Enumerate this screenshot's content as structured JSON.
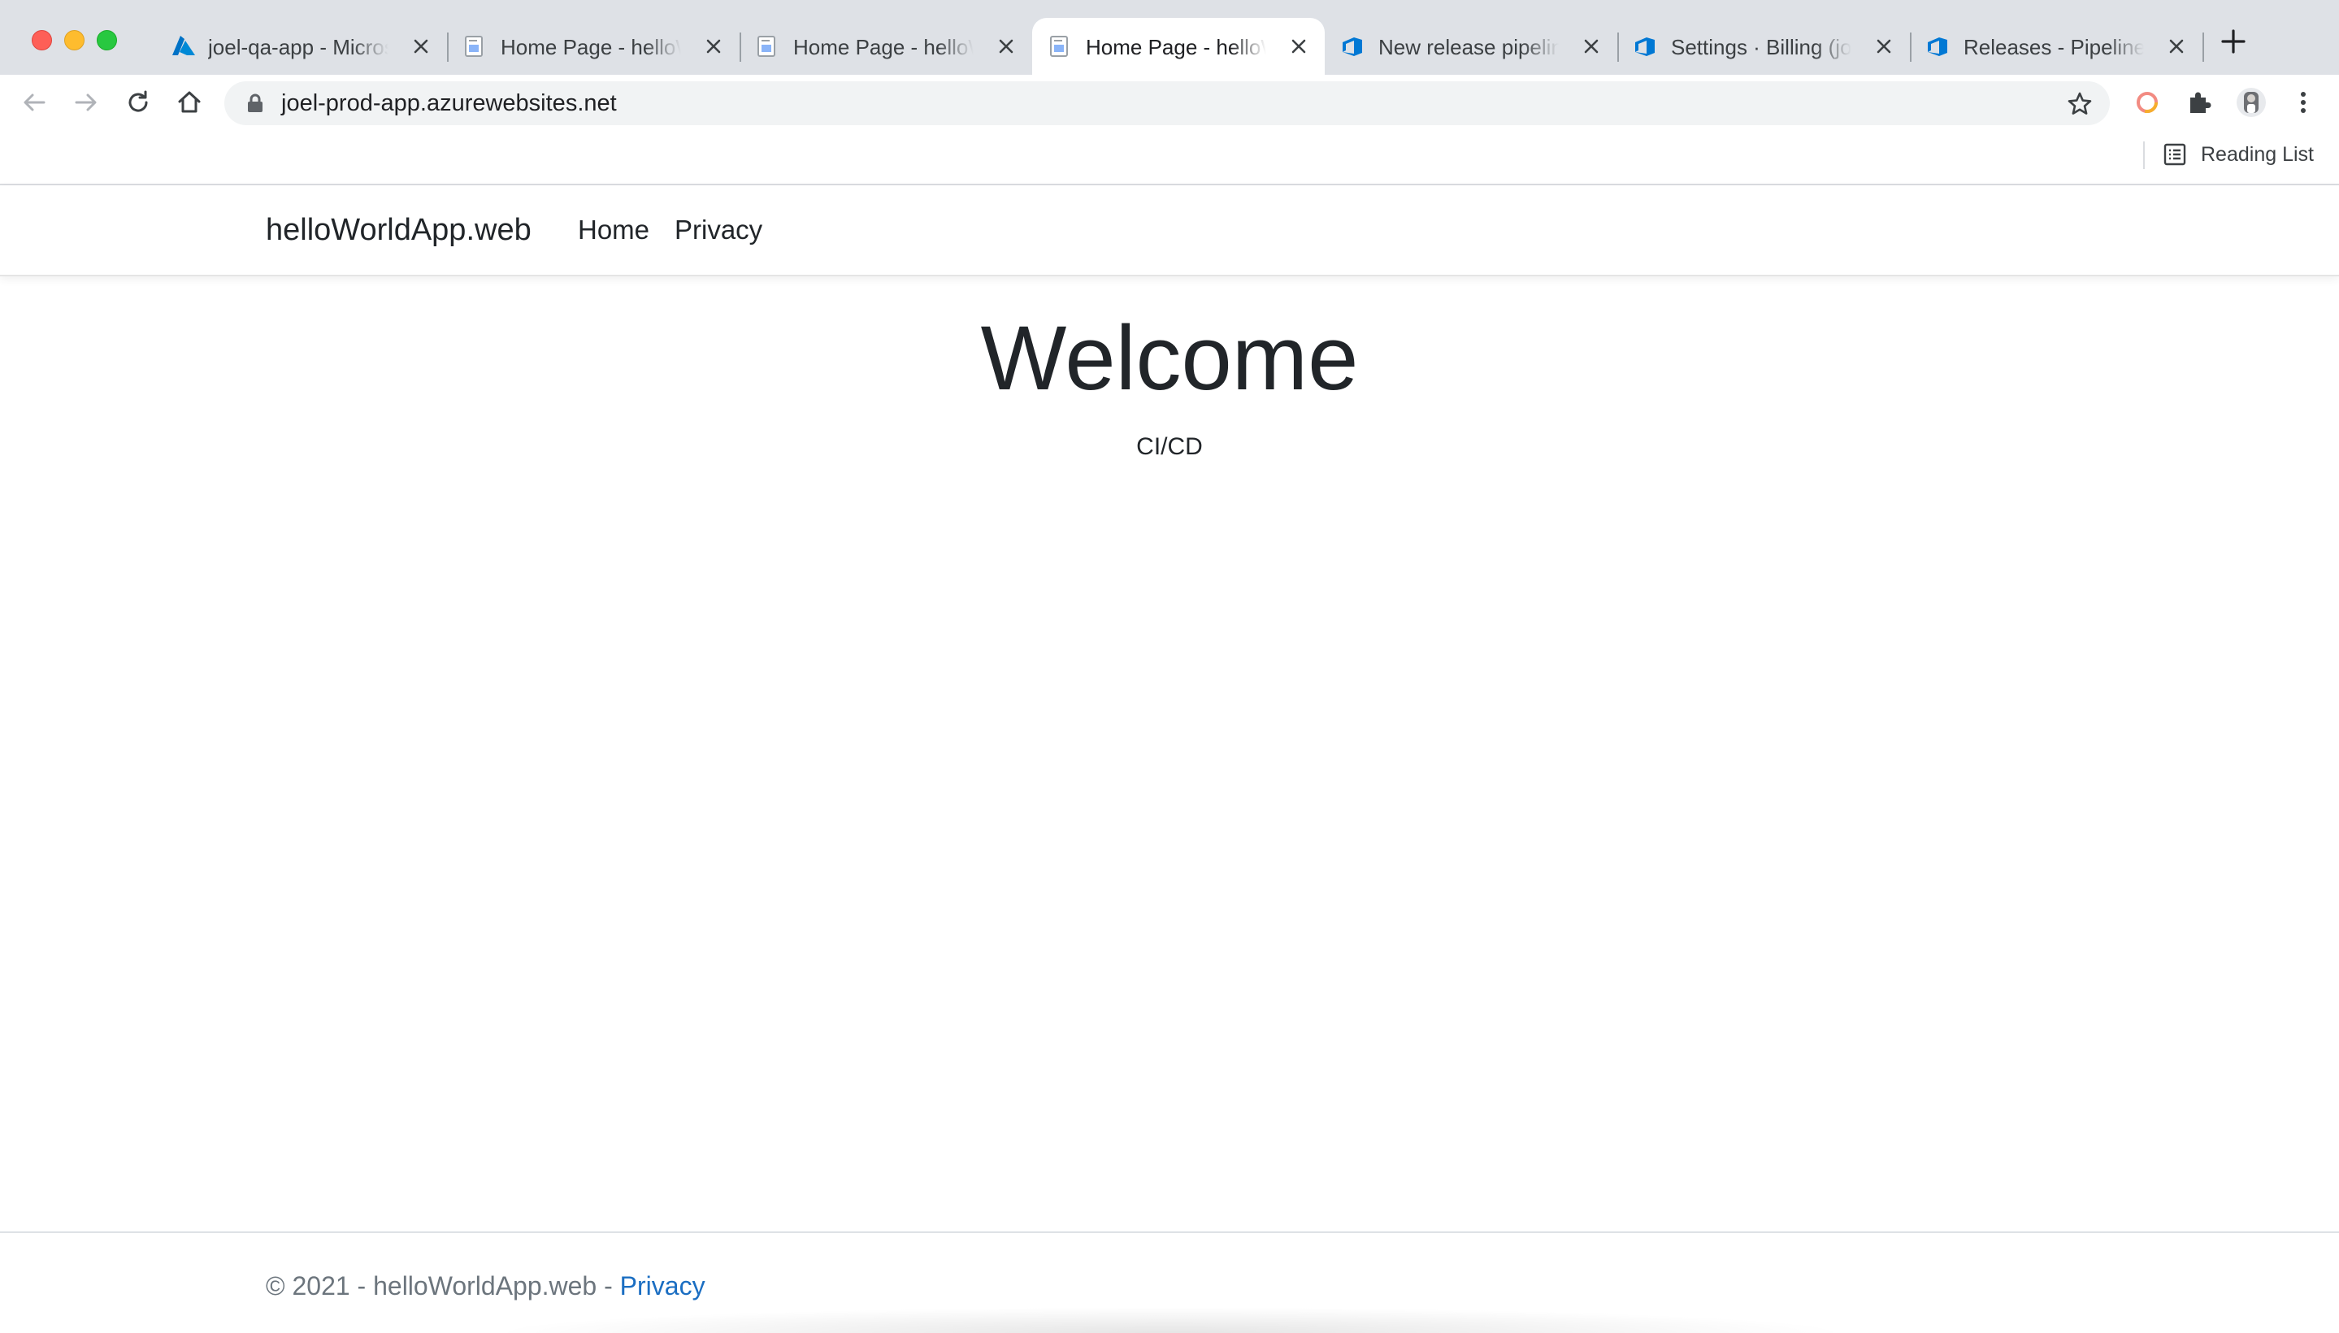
{
  "browser": {
    "tabs": [
      {
        "title": "joel-qa-app - Microsoft Azure",
        "icon": "azure-icon",
        "active": false
      },
      {
        "title": "Home Page - helloWorldApp.web",
        "icon": "page-icon",
        "active": false
      },
      {
        "title": "Home Page - helloWorldApp.web",
        "icon": "page-icon",
        "active": false
      },
      {
        "title": "Home Page - helloWorldApp.web",
        "icon": "page-icon",
        "active": true
      },
      {
        "title": "New release pipeline",
        "icon": "azure-devops-icon",
        "active": false
      },
      {
        "title": "Settings · Billing (joel)",
        "icon": "azure-devops-icon",
        "active": false
      },
      {
        "title": "Releases - Pipelines",
        "icon": "azure-devops-icon",
        "active": false
      }
    ],
    "address_bar": {
      "url": "joel-prod-app.azurewebsites.net"
    },
    "bookmarks": {
      "reading_list": "Reading List"
    },
    "colors": {
      "tabstrip_bg": "#dee1e6",
      "azure_blue": "#0078d4",
      "link_blue": "#1b6ec2"
    }
  },
  "site": {
    "brand": "helloWorldApp.web",
    "nav": [
      {
        "label": "Home"
      },
      {
        "label": "Privacy"
      }
    ],
    "heading": "Welcome",
    "lead": "CI/CD",
    "footer": {
      "copyright": "© 2021 - helloWorldApp.web - ",
      "privacy_link": "Privacy"
    }
  }
}
